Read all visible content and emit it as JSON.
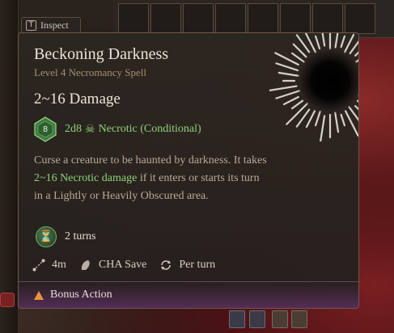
{
  "inspect": {
    "key": "T",
    "label": "Inspect"
  },
  "spell": {
    "name": "Beckoning Darkness",
    "subtitle": "Level 4 Necromancy Spell",
    "damage_heading": "2~16 Damage",
    "damage_dice": "2d8",
    "damage_type": "Necrotic (Conditional)",
    "die_number": "8",
    "description_pre": "Curse a creature to be haunted by darkness. It takes ",
    "description_highlight": "2~16 Necrotic damage",
    "description_post": " if it enters or starts its turn in a Lightly or Heavily Obscured area.",
    "duration": "2 turns",
    "range": "4m",
    "save": "CHA Save",
    "frequency": "Per turn",
    "action_type": "Bonus Action"
  },
  "icons": {
    "die": "d8-die-icon",
    "necrotic": "necrotic-icon",
    "duration": "duration-icon",
    "range": "range-icon",
    "save": "save-icon",
    "repeat": "repeat-icon",
    "bonus": "bonus-action-icon"
  },
  "colors": {
    "accent_green": "#8fd17a",
    "title": "#ece4d8",
    "subtitle": "#a8906f",
    "bonus_action": "#e8923a"
  }
}
